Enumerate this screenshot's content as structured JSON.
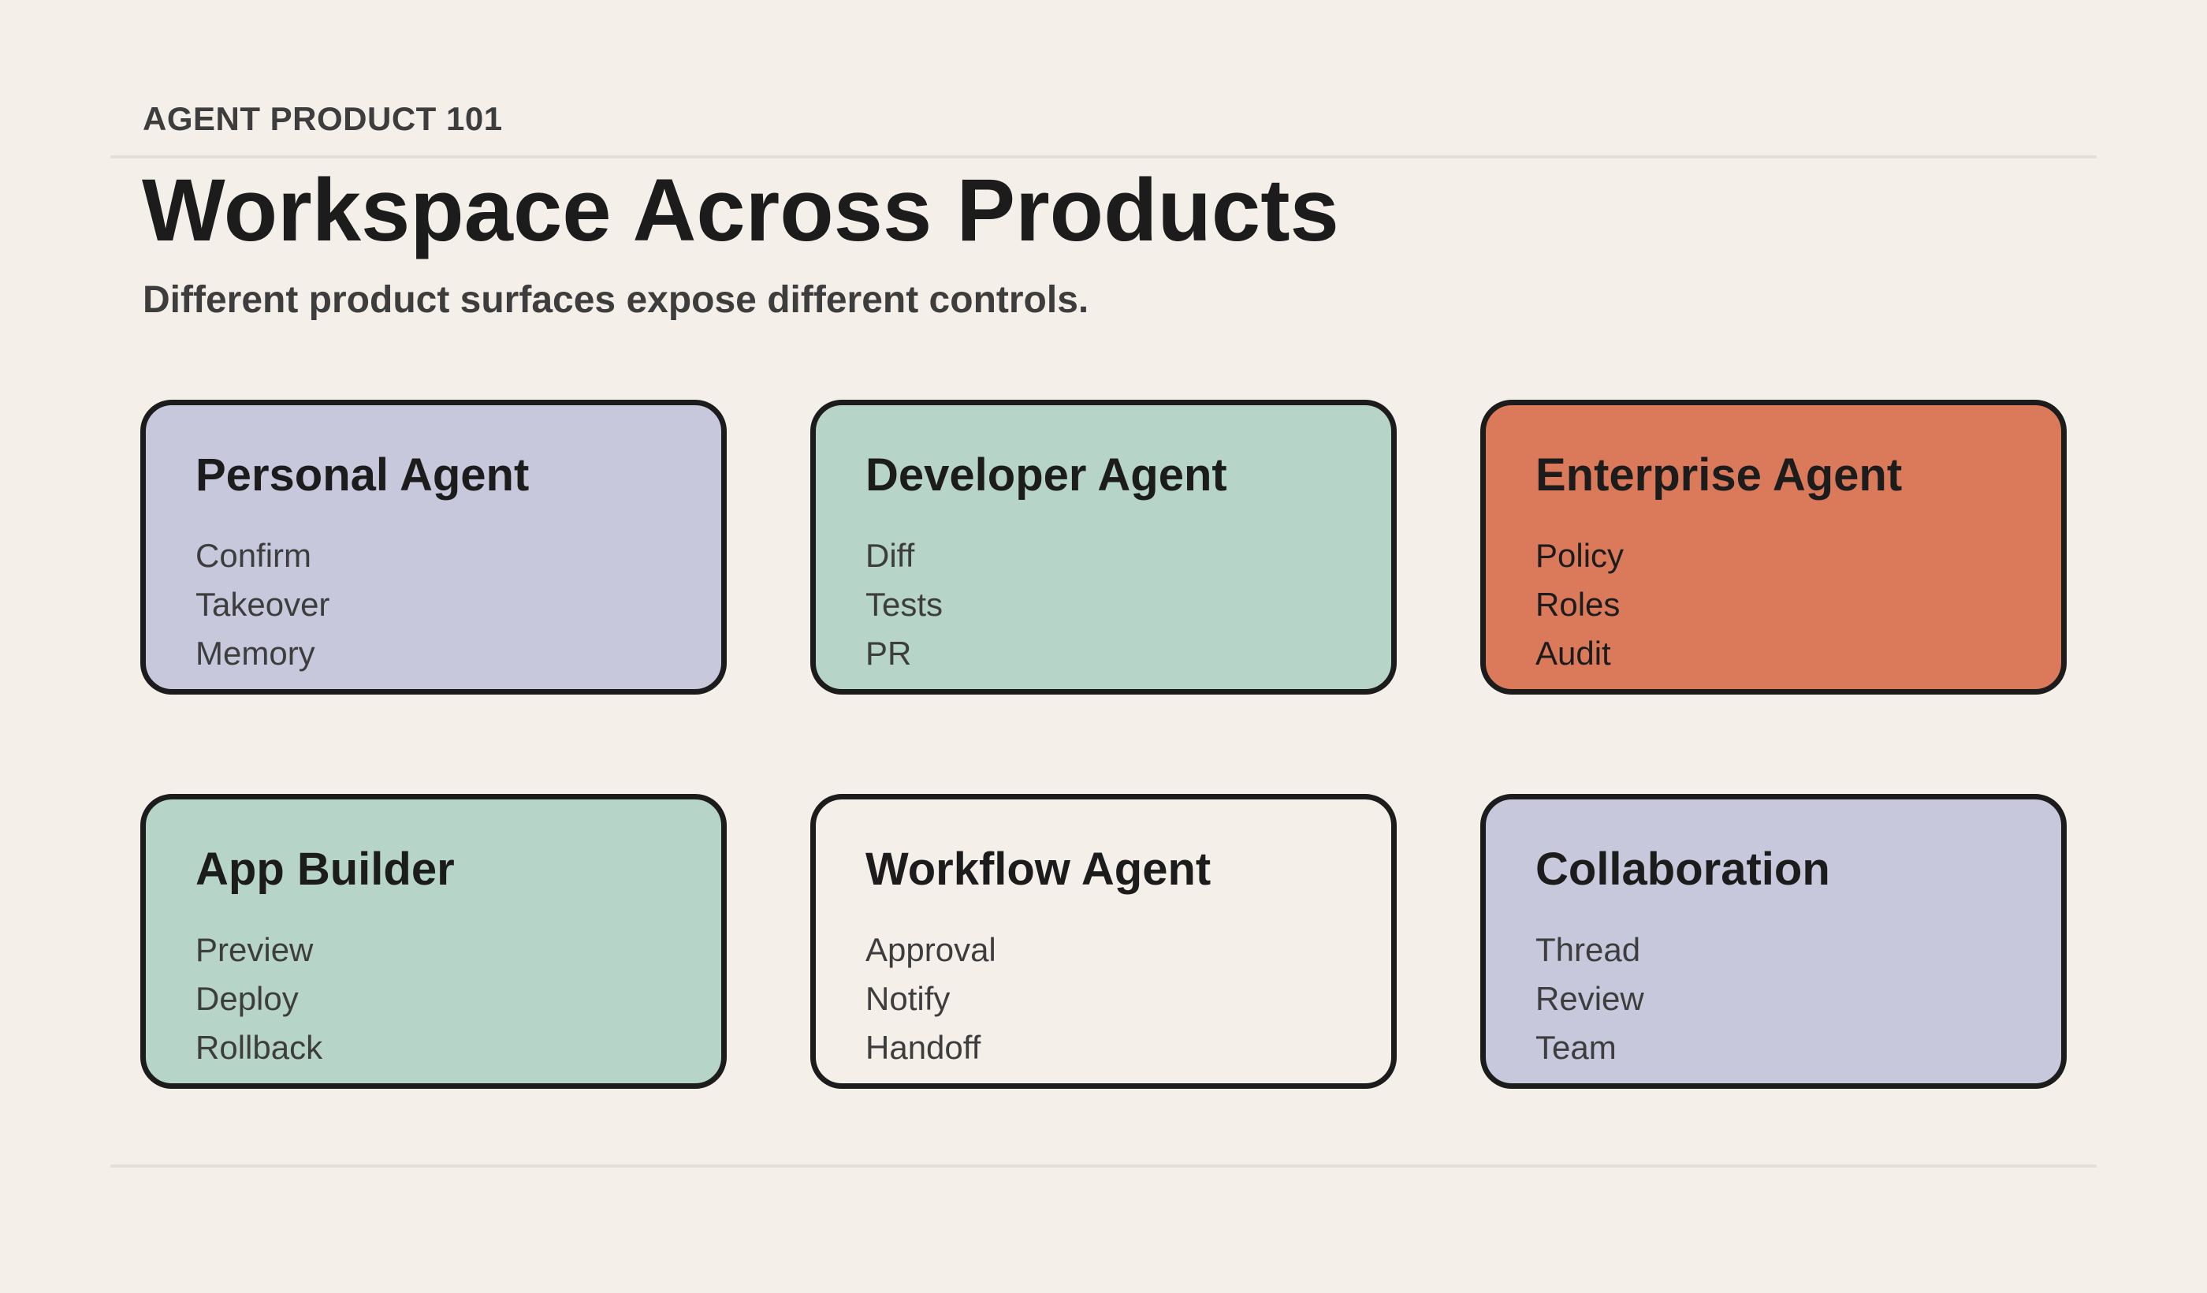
{
  "header": {
    "eyebrow": "AGENT PRODUCT 101",
    "title": "Workspace Across Products",
    "subtitle": "Different product surfaces expose different controls."
  },
  "colors": {
    "background": "#f4f0e9",
    "lavender": "#c8c8dc",
    "mint": "#b7d4c8",
    "coral": "#db7a5b",
    "cream": "#f4f0e9",
    "ink": "#1c1c1c"
  },
  "cards": [
    {
      "title": "Personal Agent",
      "color": "#c8c8dc",
      "items": [
        "Confirm",
        "Takeover",
        "Memory"
      ]
    },
    {
      "title": "Developer Agent",
      "color": "#b7d4c8",
      "items": [
        "Diff",
        "Tests",
        "PR"
      ]
    },
    {
      "title": "Enterprise Agent",
      "color": "#db7a5b",
      "items": [
        "Policy",
        "Roles",
        "Audit"
      ]
    },
    {
      "title": "App Builder",
      "color": "#b7d4c8",
      "items": [
        "Preview",
        "Deploy",
        "Rollback"
      ]
    },
    {
      "title": "Workflow Agent",
      "color": "#f4f0e9",
      "items": [
        "Approval",
        "Notify",
        "Handoff"
      ]
    },
    {
      "title": "Collaboration",
      "color": "#c8c8dc",
      "items": [
        "Thread",
        "Review",
        "Team"
      ]
    }
  ]
}
